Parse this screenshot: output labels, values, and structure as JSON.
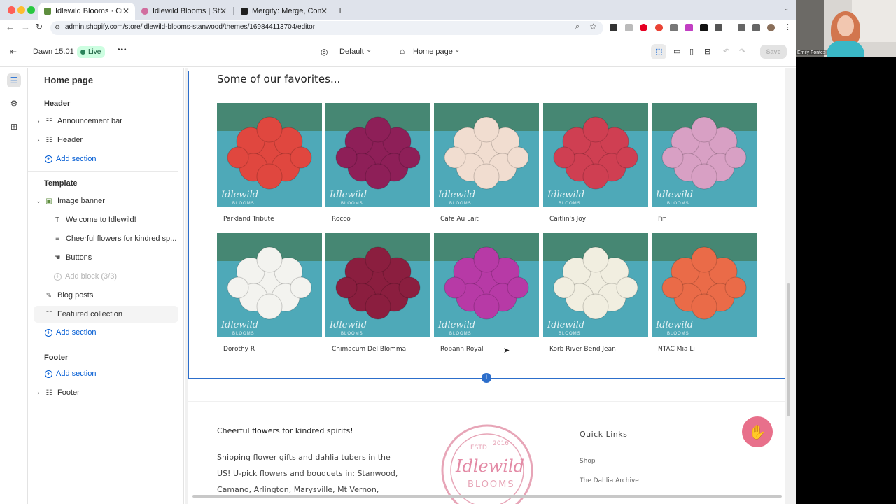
{
  "browser": {
    "tabs": [
      {
        "title": "Idlewild Blooms · Customize D",
        "active": true,
        "favicon_color": "#5e8e3e"
      },
      {
        "title": "Idlewild Blooms | Stanwood F",
        "active": false,
        "favicon_color": "#d16d9e"
      },
      {
        "title": "Mergify: Merge, Combine Ord",
        "active": false,
        "favicon_color": "#1f1f1f"
      }
    ],
    "url": "admin.shopify.com/store/idlewild-blooms-stanwood/themes/169844113704/editor"
  },
  "topbar": {
    "theme_name": "Dawn 15.01",
    "status": "Live",
    "more_label": "•••",
    "default_label": "Default",
    "page_label": "Home page",
    "save_label": "Save"
  },
  "sidebar": {
    "title": "Home page",
    "header_group": "Header",
    "header_items": [
      "Announcement bar",
      "Header"
    ],
    "add_section": "Add section",
    "template_group": "Template",
    "image_banner": "Image banner",
    "banner_blocks": [
      "Welcome to Idlewild!",
      "Cheerful flowers for kindred sp...",
      "Buttons"
    ],
    "add_block": "Add block (3/3)",
    "template_items": [
      "Blog posts",
      "Featured collection"
    ],
    "footer_group": "Footer",
    "footer_item": "Footer"
  },
  "preview": {
    "section_title": "Some of our favorites...",
    "products": [
      {
        "name": "Parkland Tribute",
        "color": "#e0473f"
      },
      {
        "name": "Rocco",
        "color": "#8e1f58"
      },
      {
        "name": "Cafe Au Lait",
        "color": "#f1ddd0"
      },
      {
        "name": "Caitlin's Joy",
        "color": "#cf3f52"
      },
      {
        "name": "Fifi",
        "color": "#d8a0c4"
      },
      {
        "name": "Dorothy R",
        "color": "#f3f3ef"
      },
      {
        "name": "Chimacum Del Blomma",
        "color": "#8b1e3f"
      },
      {
        "name": "Robann Royal",
        "color": "#b73aa6"
      },
      {
        "name": "Korb River Bend Jean",
        "color": "#f1eee0"
      },
      {
        "name": "NTAC Mia Li",
        "color": "#ea6b48"
      }
    ],
    "watermark": "Idlewild",
    "watermark_sub": "BLOOMS",
    "footer_title": "Cheerful flowers for kindred spirits!",
    "footer_body": "Shipping flower gifts and dahlia tubers in the US! U-pick flowers and bouquets in: Stanwood, Camano, Arlington, Marysville, Mt Vernon,",
    "seal_top": "ESTD",
    "seal_year": "2016",
    "seal_name": "Idlewild",
    "seal_sub": "BLOOMS",
    "quick_links_title": "Quick Links",
    "quick_links": [
      "Shop",
      "The Dahlia Archive"
    ]
  },
  "webcam": {
    "name": "Emily Fontes"
  }
}
